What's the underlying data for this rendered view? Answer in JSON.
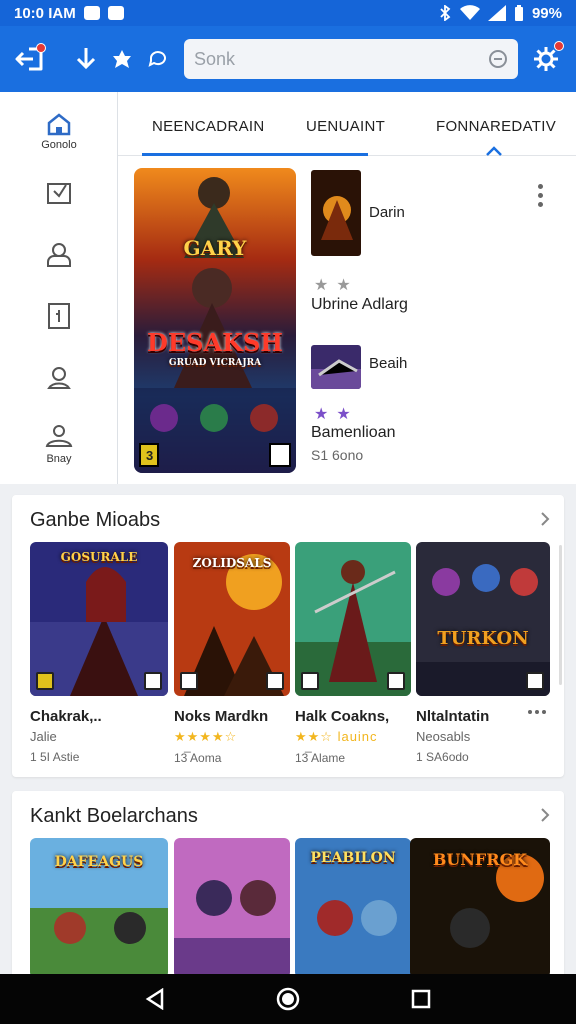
{
  "status": {
    "time": "10:0 IAM",
    "battery": "99%"
  },
  "search": {
    "placeholder": "Sonk"
  },
  "sidebar": {
    "items": [
      {
        "label": "Gonolo",
        "icon": "home-icon"
      },
      {
        "label": "",
        "icon": "download-box-icon"
      },
      {
        "label": "",
        "icon": "person-icon"
      },
      {
        "label": "",
        "icon": "lock-door-icon"
      },
      {
        "label": "",
        "icon": "location-icon"
      },
      {
        "label": "Bnay",
        "icon": "people-icon"
      }
    ]
  },
  "tabs": [
    "NEENCADRAIN",
    "UENUAINT",
    "FONNAREDATIV"
  ],
  "feature": {
    "banner_top": "GARY",
    "banner_main": "DESAKSH",
    "banner_sub": "GRUAD VICRAJRA",
    "rating_badge": "3"
  },
  "side_list": {
    "item1_title": "Darin",
    "item1_name": "Ubrine Adlarg",
    "item2_title": "Beaih",
    "item2_name": "Bamenlioan",
    "item2_sub": "S1 6ono"
  },
  "section1": {
    "title": "Ganbe Mioabs",
    "cards": [
      {
        "art": "GOSURALE",
        "name": "Chakrak,..",
        "sub": "Jalie",
        "meta": "1 5I Astie"
      },
      {
        "art": "ZOLIDSALS",
        "name": "Noks Mardkn",
        "sub": "★★★★☆",
        "meta": "13̅ Aoma"
      },
      {
        "art": "",
        "name": "Halk Coakns,",
        "sub": "★★☆ lauinc",
        "meta": "13̅ Alame"
      },
      {
        "art": "TURKON",
        "name": "Nltalntatin",
        "sub": "Neosabls",
        "meta": "1 SA6odo"
      }
    ]
  },
  "section2": {
    "title": "Kankt Boelarchans",
    "cards": [
      {
        "art": "DAFEAGUS"
      },
      {
        "art": ""
      },
      {
        "art": "PEABILON"
      },
      {
        "art": "BUNFRGK"
      }
    ]
  },
  "colors": {
    "primary": "#1a6fe0",
    "statusbar": "#1565d8",
    "star": "#f2b61f"
  }
}
